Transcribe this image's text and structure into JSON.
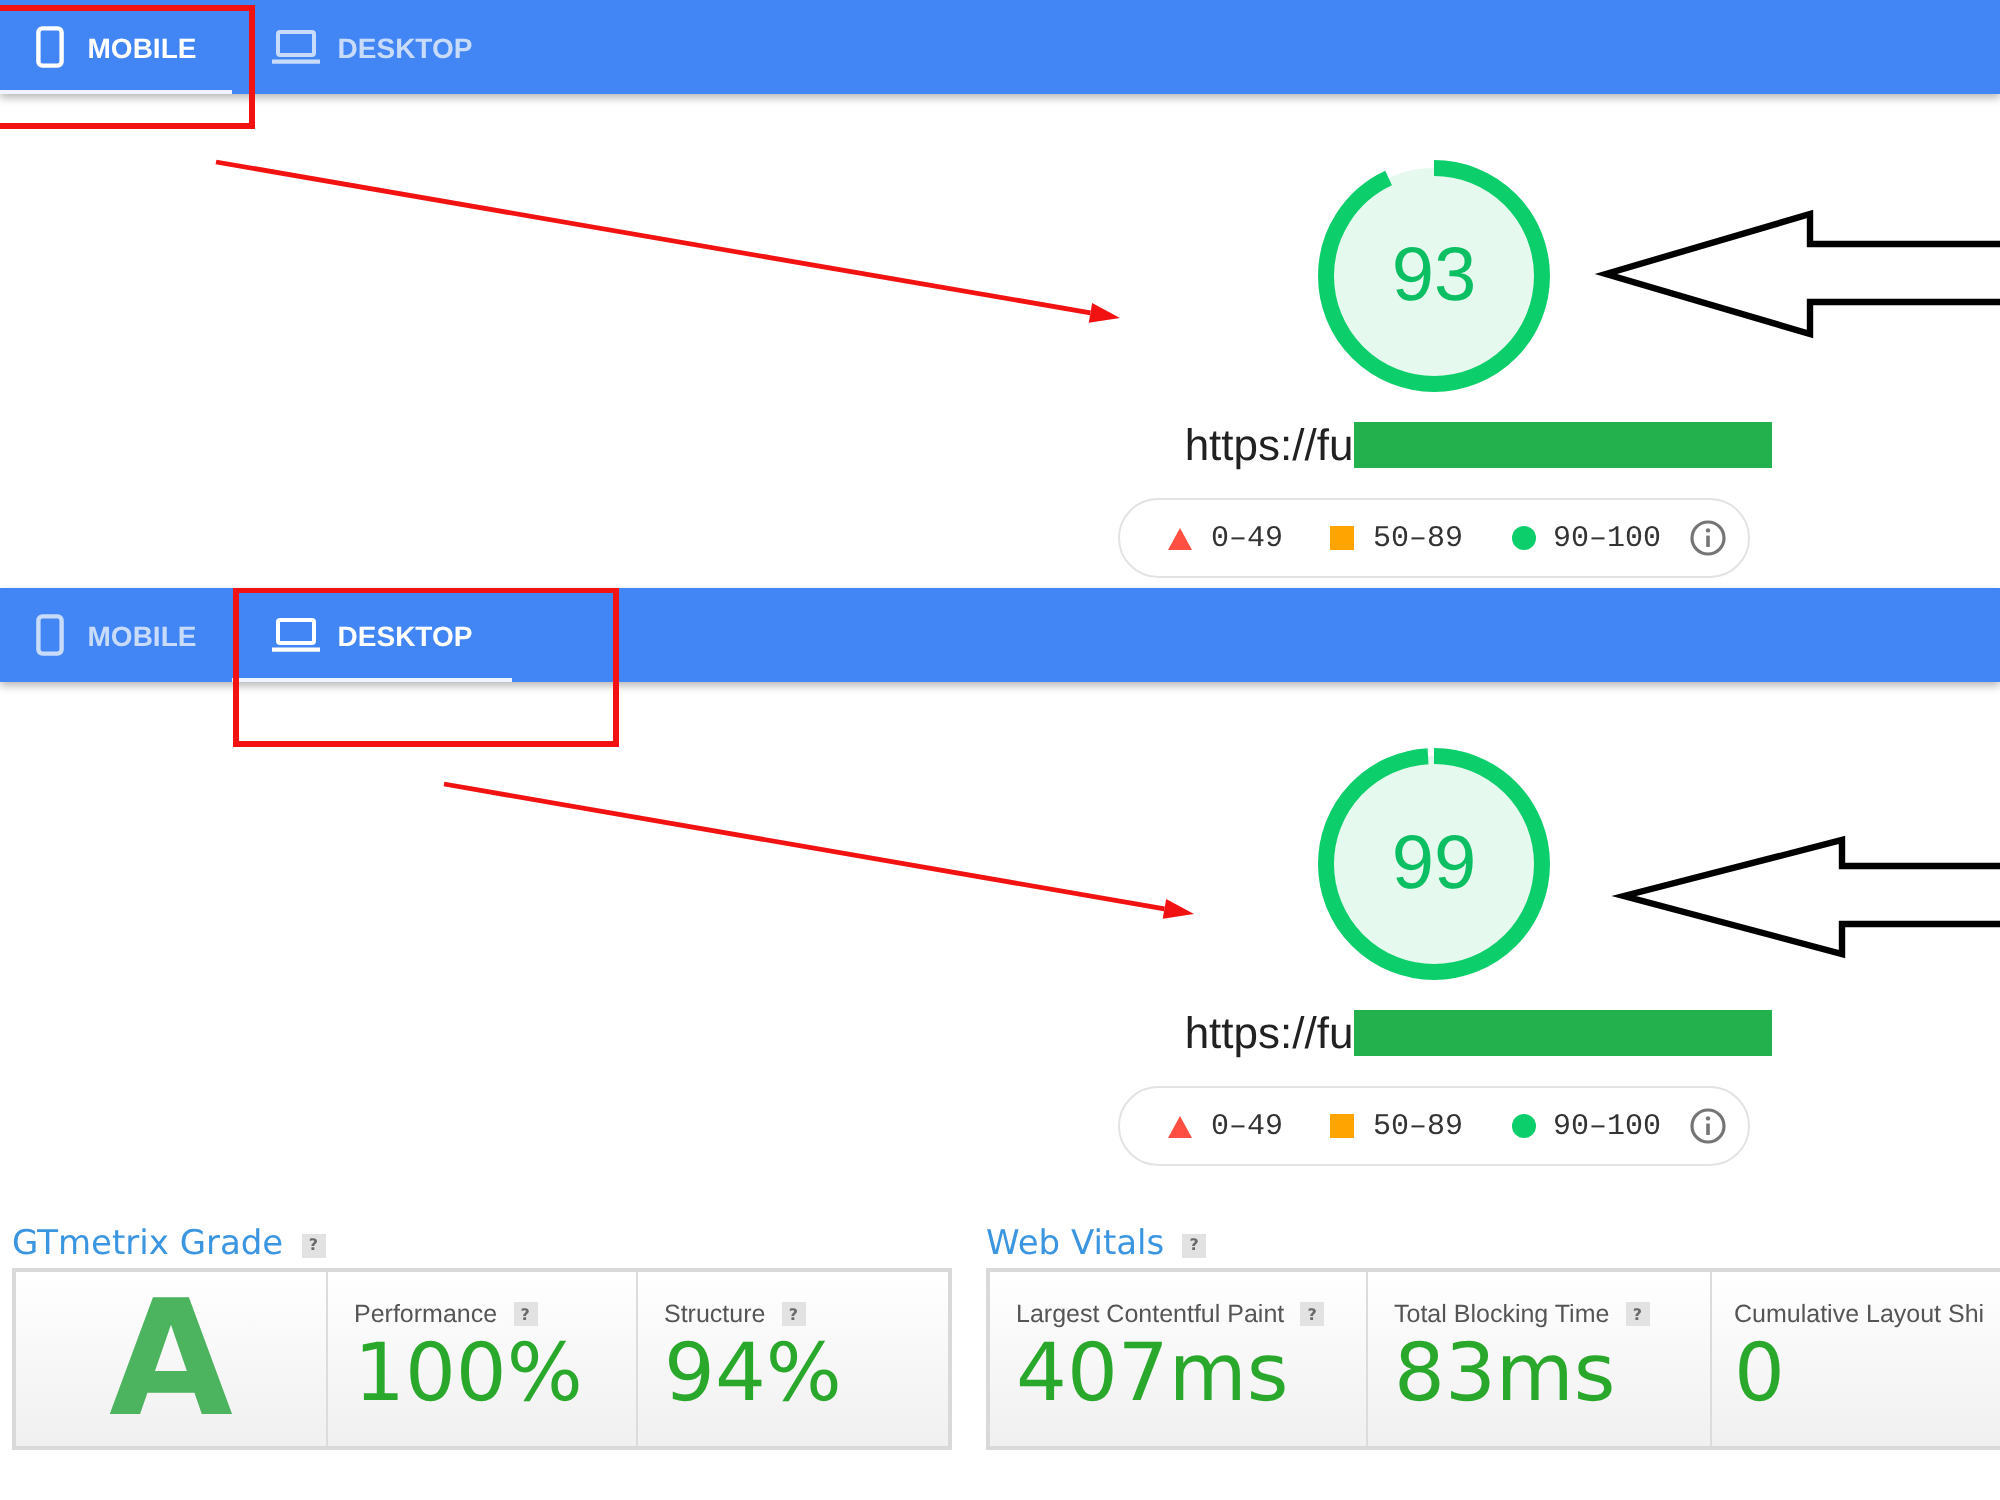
{
  "panels": [
    {
      "tabs": [
        {
          "kind": "phone",
          "label": "MOBILE",
          "selected": true
        },
        {
          "kind": "laptop",
          "label": "DESKTOP",
          "selected": false
        }
      ],
      "score": {
        "value": "93",
        "level": 0.93
      },
      "url": {
        "text": "https://fu",
        "redacted": true
      },
      "legend": [
        {
          "kind": "triangle",
          "color": "#ff4e42",
          "label": "0–49"
        },
        {
          "kind": "square",
          "color": "#ffa400",
          "label": "50–89"
        },
        {
          "kind": "circle",
          "color": "#0cce6b",
          "label": "90–100"
        }
      ]
    },
    {
      "tabs": [
        {
          "kind": "phone",
          "label": "MOBILE",
          "selected": false
        },
        {
          "kind": "laptop",
          "label": "DESKTOP",
          "selected": true
        }
      ],
      "score": {
        "value": "99",
        "level": 0.99
      },
      "url": {
        "text": "https://fu",
        "redacted": true
      },
      "legend": [
        {
          "kind": "triangle",
          "color": "#ff4e42",
          "label": "0–49"
        },
        {
          "kind": "square",
          "color": "#ffa400",
          "label": "50–89"
        },
        {
          "kind": "circle",
          "color": "#0cce6b",
          "label": "90–100"
        }
      ]
    }
  ],
  "gtmetrix_grade": {
    "title": "GTmetrix Grade",
    "help": "?",
    "grade": "A",
    "metrics": [
      {
        "label": "Performance",
        "help": "?",
        "value": "100%"
      },
      {
        "label": "Structure",
        "help": "?",
        "value": "94%"
      }
    ]
  },
  "web_vitals": {
    "title": "Web Vitals",
    "help": "?",
    "metrics": [
      {
        "label": "Largest Contentful Paint",
        "help": "?",
        "value": "407ms"
      },
      {
        "label": "Total Blocking Time",
        "help": "?",
        "value": "83ms"
      },
      {
        "label": "Cumulative Layout Shi",
        "value": "0"
      }
    ]
  }
}
